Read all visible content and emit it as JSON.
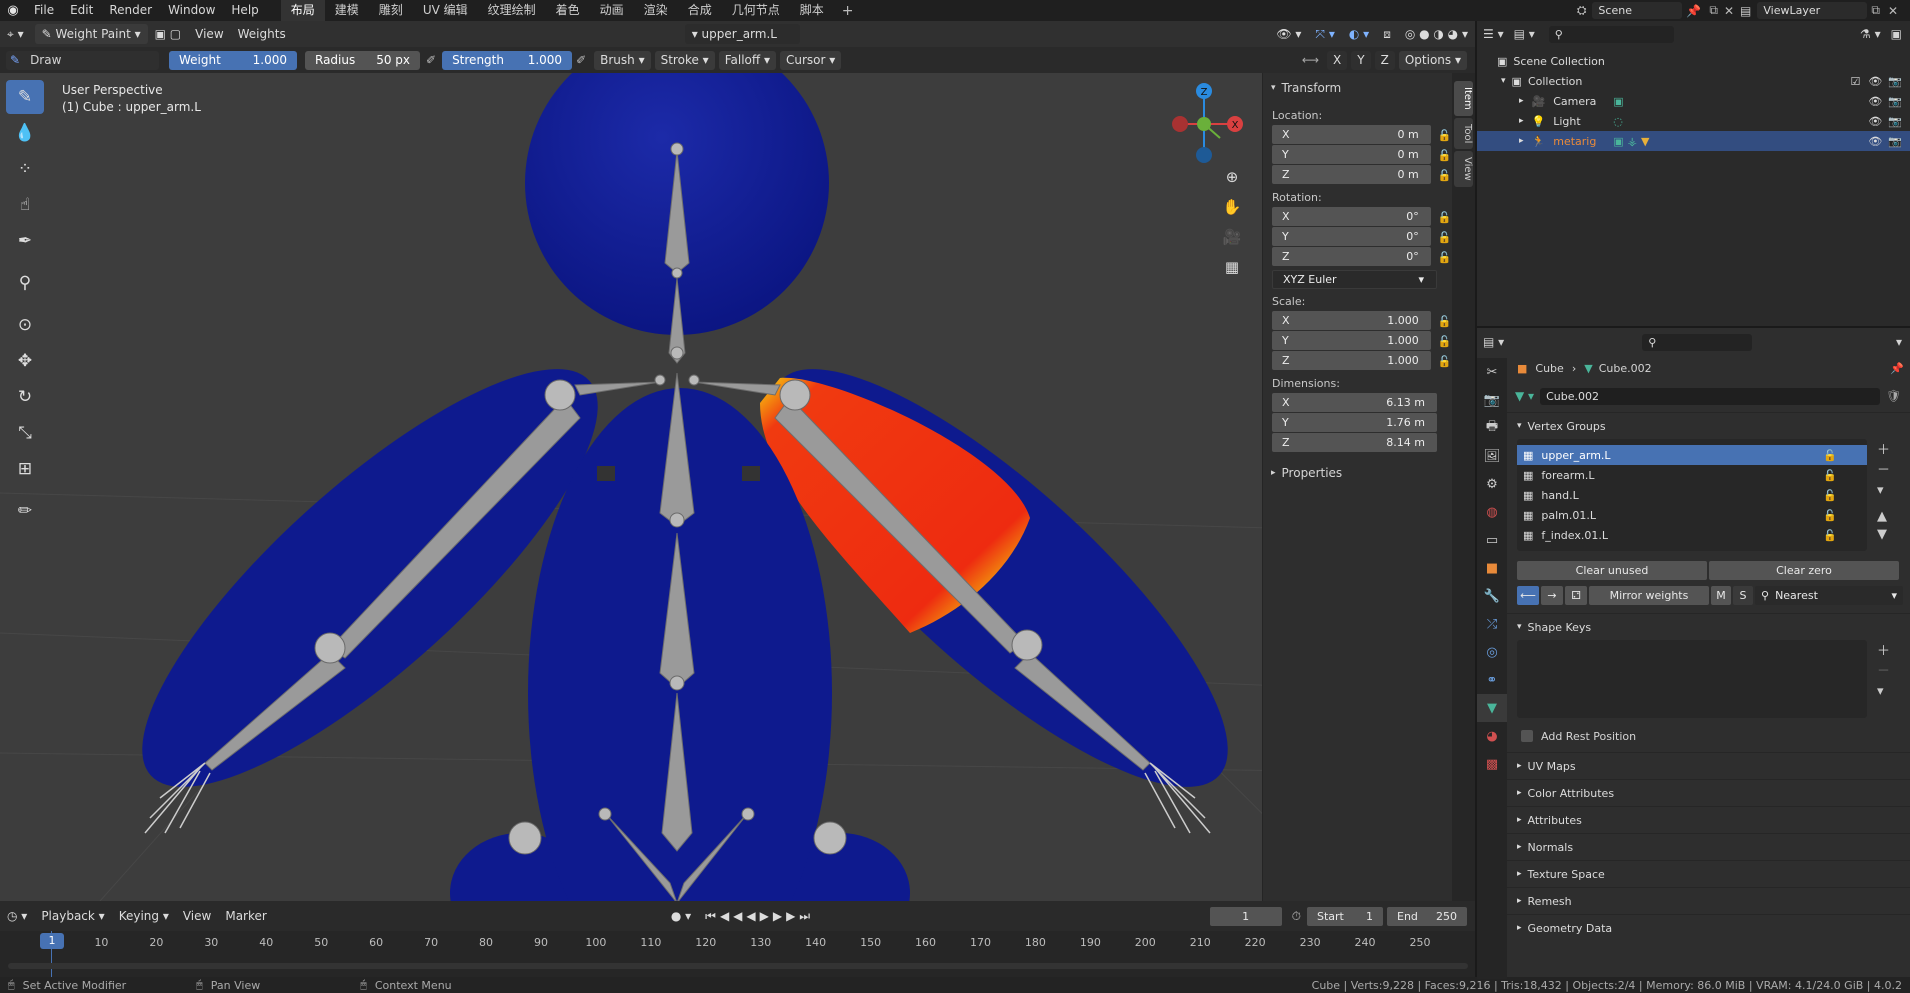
{
  "topbar": {
    "menus": [
      "File",
      "Edit",
      "Render",
      "Window",
      "Help"
    ],
    "workspaces": [
      "布局",
      "建模",
      "雕刻",
      "UV 编辑",
      "纹理绘制",
      "着色",
      "动画",
      "渲染",
      "合成",
      "几何节点",
      "脚本"
    ],
    "add_label": "+",
    "scene": "Scene",
    "view_layer": "ViewLayer"
  },
  "viewport_header": {
    "mode": "Weight Paint",
    "menus": [
      "View",
      "Weights"
    ],
    "vertex_group": "upper_arm.L"
  },
  "tool_settings": {
    "brush_name": "Draw",
    "weight_label": "Weight",
    "weight_value": "1.000",
    "radius_label": "Radius",
    "radius_value": "50 px",
    "strength_label": "Strength",
    "strength_value": "1.000",
    "dropdowns": [
      "Brush",
      "Stroke",
      "Falloff",
      "Cursor"
    ],
    "axes": [
      "X",
      "Y",
      "Z"
    ],
    "options": "Options"
  },
  "viewport": {
    "view_name": "User Perspective",
    "object_info": "(1) Cube : upper_arm.L",
    "gizmo": {
      "x": "X",
      "y": "Y",
      "z": "Z"
    }
  },
  "npanel": {
    "tabs": [
      "Item",
      "Tool",
      "View"
    ],
    "transform_title": "Transform",
    "location_label": "Location:",
    "location": [
      {
        "axis": "X",
        "value": "0 m"
      },
      {
        "axis": "Y",
        "value": "0 m"
      },
      {
        "axis": "Z",
        "value": "0 m"
      }
    ],
    "rotation_label": "Rotation:",
    "rotation": [
      {
        "axis": "X",
        "value": "0°"
      },
      {
        "axis": "Y",
        "value": "0°"
      },
      {
        "axis": "Z",
        "value": "0°"
      }
    ],
    "rotation_mode": "XYZ Euler",
    "scale_label": "Scale:",
    "scale": [
      {
        "axis": "X",
        "value": "1.000"
      },
      {
        "axis": "Y",
        "value": "1.000"
      },
      {
        "axis": "Z",
        "value": "1.000"
      }
    ],
    "dimensions_label": "Dimensions:",
    "dimensions": [
      {
        "axis": "X",
        "value": "6.13 m"
      },
      {
        "axis": "Y",
        "value": "1.76 m"
      },
      {
        "axis": "Z",
        "value": "8.14 m"
      }
    ],
    "properties_title": "Properties"
  },
  "timeline": {
    "menus": [
      "Playback",
      "Keying",
      "View",
      "Marker"
    ],
    "current_frame": "1",
    "start_label": "Start",
    "start": "1",
    "end_label": "End",
    "end": "250",
    "ticks": [
      "1",
      "10",
      "20",
      "30",
      "40",
      "50",
      "60",
      "70",
      "80",
      "90",
      "100",
      "110",
      "120",
      "130",
      "140",
      "150",
      "160",
      "170",
      "180",
      "190",
      "200",
      "210",
      "220",
      "230",
      "240",
      "250"
    ]
  },
  "status": {
    "left": "Set Active Modifier",
    "middle": "Pan View",
    "right": "Context Menu",
    "stats": "Cube | Verts:9,228 | Faces:9,216 | Tris:18,432 | Objects:2/4 | Memory: 86.0 MiB | VRAM: 4.1/24.0 GiB | 4.0.2"
  },
  "outliner": {
    "scene_collection": "Scene Collection",
    "collection": "Collection",
    "items": [
      {
        "name": "Camera",
        "color": "#dcdcdc"
      },
      {
        "name": "Light",
        "color": "#dcdcdc"
      },
      {
        "name": "metarig",
        "color": "#e88a3a"
      }
    ]
  },
  "properties": {
    "breadcrumb_object": "Cube",
    "breadcrumb_data": "Cube.002",
    "mesh_name": "Cube.002",
    "vertex_groups_title": "Vertex Groups",
    "vertex_groups": [
      "upper_arm.L",
      "forearm.L",
      "hand.L",
      "palm.01.L",
      "f_index.01.L"
    ],
    "clear_unused": "Clear unused",
    "clear_zero": "Clear zero",
    "mirror_weights": "Mirror weights",
    "mirror_m": "M",
    "mirror_s": "S",
    "nearest": "Nearest",
    "shape_keys_title": "Shape Keys",
    "add_rest_position": "Add Rest Position",
    "sections": [
      "UV Maps",
      "Color Attributes",
      "Attributes",
      "Normals",
      "Texture Space",
      "Remesh",
      "Geometry Data"
    ]
  },
  "colors": {
    "accent": "#4772b3",
    "mesh_blue": "#0e1a8e",
    "weight_red": "#ee2b10"
  }
}
